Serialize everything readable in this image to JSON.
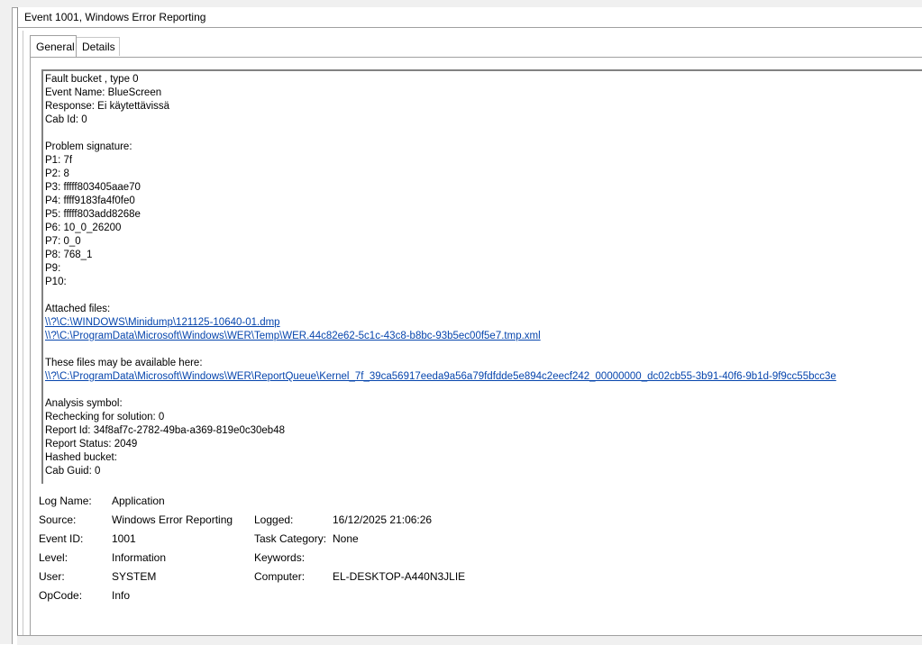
{
  "window": {
    "title": "Event 1001, Windows Error Reporting"
  },
  "tabs": [
    {
      "label": "General",
      "active": true
    },
    {
      "label": "Details",
      "active": false
    }
  ],
  "description": {
    "lines": [
      {
        "text": "Fault bucket , type 0",
        "link": false
      },
      {
        "text": "Event Name: BlueScreen",
        "link": false
      },
      {
        "text": "Response: Ei käytettävissä",
        "link": false
      },
      {
        "text": "Cab Id: 0",
        "link": false
      },
      {
        "text": "",
        "link": false
      },
      {
        "text": "Problem signature:",
        "link": false
      },
      {
        "text": "P1: 7f",
        "link": false
      },
      {
        "text": "P2: 8",
        "link": false
      },
      {
        "text": "P3: fffff803405aae70",
        "link": false
      },
      {
        "text": "P4: ffff9183fa4f0fe0",
        "link": false
      },
      {
        "text": "P5: fffff803add8268e",
        "link": false
      },
      {
        "text": "P6: 10_0_26200",
        "link": false
      },
      {
        "text": "P7: 0_0",
        "link": false
      },
      {
        "text": "P8: 768_1",
        "link": false
      },
      {
        "text": "P9:",
        "link": false
      },
      {
        "text": "P10:",
        "link": false
      },
      {
        "text": "",
        "link": false
      },
      {
        "text": "Attached files:",
        "link": false
      },
      {
        "text": "\\\\?\\C:\\WINDOWS\\Minidump\\121125-10640-01.dmp",
        "link": true
      },
      {
        "text": "\\\\?\\C:\\ProgramData\\Microsoft\\Windows\\WER\\Temp\\WER.44c82e62-5c1c-43c8-b8bc-93b5ec00f5e7.tmp.xml",
        "link": true
      },
      {
        "text": "",
        "link": false
      },
      {
        "text": "These files may be available here:",
        "link": false
      },
      {
        "text": "\\\\?\\C:\\ProgramData\\Microsoft\\Windows\\WER\\ReportQueue\\Kernel_7f_39ca56917eeda9a56a79fdfdde5e894c2eecf242_00000000_dc02cb55-3b91-40f6-9b1d-9f9cc55bcc3e",
        "link": true
      },
      {
        "text": "",
        "link": false
      },
      {
        "text": "Analysis symbol:",
        "link": false
      },
      {
        "text": "Rechecking for solution: 0",
        "link": false
      },
      {
        "text": "Report Id: 34f8af7c-2782-49ba-a369-819e0c30eb48",
        "link": false
      },
      {
        "text": "Report Status: 2049",
        "link": false
      },
      {
        "text": "Hashed bucket:",
        "link": false
      },
      {
        "text": "Cab Guid: 0",
        "link": false
      }
    ]
  },
  "properties": {
    "log_name_label": "Log Name:",
    "log_name_value": "Application",
    "source_label": "Source:",
    "source_value": "Windows Error Reporting",
    "logged_label": "Logged:",
    "logged_value": "16/12/2025 21:06:26",
    "event_id_label": "Event ID:",
    "event_id_value": "1001",
    "task_category_label": "Task Category:",
    "task_category_value": "None",
    "level_label": "Level:",
    "level_value": "Information",
    "keywords_label": "Keywords:",
    "keywords_value": "",
    "user_label": "User:",
    "user_value": "SYSTEM",
    "computer_label": "Computer:",
    "computer_value": "EL-DESKTOP-A440N3JLIE",
    "opcode_label": "OpCode:",
    "opcode_value": "Info"
  },
  "colors": {
    "link": "#0645ad",
    "border": "#a0a0a0"
  }
}
